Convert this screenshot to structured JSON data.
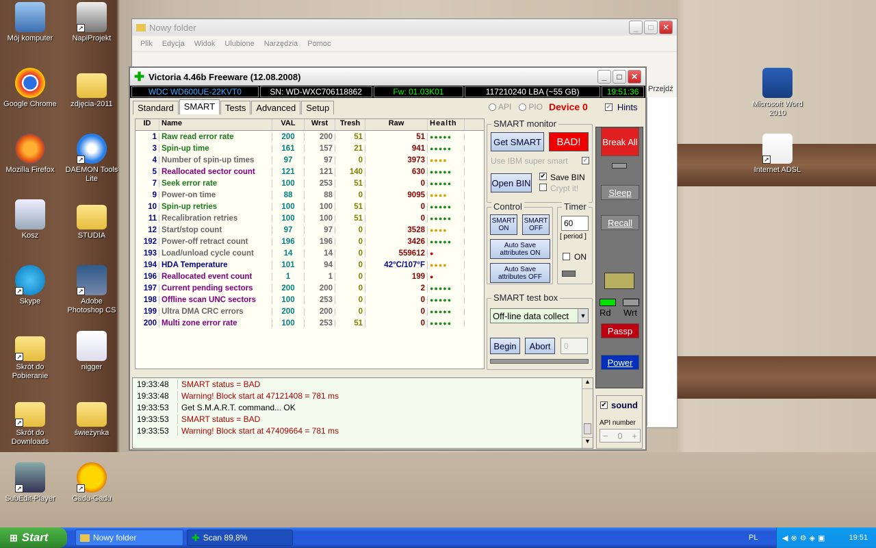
{
  "desktop": {
    "icons": [
      {
        "label": "Mój komputer",
        "shortcut": false
      },
      {
        "label": "NapiProjekt",
        "shortcut": true
      },
      {
        "label": "Google Chrome",
        "shortcut": false
      },
      {
        "label": "zdjęcia-2011",
        "shortcut": false
      },
      {
        "label": "Mozilla Firefox",
        "shortcut": false
      },
      {
        "label": "DAEMON Tools Lite",
        "shortcut": true
      },
      {
        "label": "Kosz",
        "shortcut": false
      },
      {
        "label": "STUDIA",
        "shortcut": false
      },
      {
        "label": "Skype",
        "shortcut": true
      },
      {
        "label": "Adobe Photoshop CS",
        "shortcut": true
      },
      {
        "label": "Skrót do Pobieranie",
        "shortcut": true
      },
      {
        "label": "nigger",
        "shortcut": false
      },
      {
        "label": "Skrót do Downloads",
        "shortcut": true
      },
      {
        "label": "świeżynka",
        "shortcut": false
      },
      {
        "label": "SubEdit-Player",
        "shortcut": true
      },
      {
        "label": "Gadu-Gadu",
        "shortcut": true
      },
      {
        "label": "Microsoft Word 2010",
        "shortcut": false
      },
      {
        "label": "Internet ADSL",
        "shortcut": true
      }
    ]
  },
  "explorer": {
    "title": "Nowy folder",
    "menu": [
      "Plik",
      "Edycja",
      "Widok",
      "Ulubione",
      "Narzędzia",
      "Pomoc"
    ],
    "go_label": "Przejdź"
  },
  "victoria": {
    "title": "Victoria 4.46b Freeware (12.08.2008)",
    "info": {
      "model": "WDC WD600UE-22KVT0",
      "sn": "SN: WD-WXC706118862",
      "fw": "Fw: 01.03K01",
      "lba": "117210240 LBA (~55 GB)",
      "clock": "19:51:36"
    },
    "tabs": [
      "Standard",
      "SMART",
      "Tests",
      "Advanced",
      "Setup"
    ],
    "api_label": "API",
    "pio_label": "PIO",
    "device_label": "Device 0",
    "hints_label": "Hints",
    "grid_headers": [
      "ID",
      "Name",
      "VAL",
      "Wrst",
      "Tresh",
      "Raw",
      "Health"
    ],
    "rows": [
      {
        "id": "1",
        "name": "Raw read error rate",
        "val": "200",
        "wrst": "200",
        "tr": "51",
        "raw": "51",
        "h": "●●●●●",
        "nc": "#1a7a1a",
        "hc": "#1a8a1a"
      },
      {
        "id": "3",
        "name": "Spin-up time",
        "val": "161",
        "wrst": "157",
        "tr": "21",
        "raw": "941",
        "h": "●●●●●",
        "nc": "#1a7a1a",
        "hc": "#1a8a1a"
      },
      {
        "id": "4",
        "name": "Number of spin-up times",
        "val": "97",
        "wrst": "97",
        "tr": "0",
        "raw": "3973",
        "h": "●●●●",
        "nc": "#666",
        "hc": "#d9a000"
      },
      {
        "id": "5",
        "name": "Reallocated sector count",
        "val": "121",
        "wrst": "121",
        "tr": "140",
        "raw": "630",
        "h": "●●●●●",
        "nc": "#800080",
        "hc": "#1a8a1a"
      },
      {
        "id": "7",
        "name": "Seek error rate",
        "val": "100",
        "wrst": "253",
        "tr": "51",
        "raw": "0",
        "h": "●●●●●",
        "nc": "#1a7a1a",
        "hc": "#1a8a1a"
      },
      {
        "id": "9",
        "name": "Power-on time",
        "val": "88",
        "wrst": "88",
        "tr": "0",
        "raw": "9095",
        "h": "●●●●",
        "nc": "#666",
        "hc": "#d9a000"
      },
      {
        "id": "10",
        "name": "Spin-up retries",
        "val": "100",
        "wrst": "100",
        "tr": "51",
        "raw": "0",
        "h": "●●●●●",
        "nc": "#1a7a1a",
        "hc": "#1a8a1a"
      },
      {
        "id": "11",
        "name": "Recalibration retries",
        "val": "100",
        "wrst": "100",
        "tr": "51",
        "raw": "0",
        "h": "●●●●●",
        "nc": "#666",
        "hc": "#1a8a1a"
      },
      {
        "id": "12",
        "name": "Start/stop count",
        "val": "97",
        "wrst": "97",
        "tr": "0",
        "raw": "3528",
        "h": "●●●●",
        "nc": "#666",
        "hc": "#d9a000"
      },
      {
        "id": "192",
        "name": "Power-off retract count",
        "val": "196",
        "wrst": "196",
        "tr": "0",
        "raw": "3426",
        "h": "●●●●●",
        "nc": "#666",
        "hc": "#1a8a1a"
      },
      {
        "id": "193",
        "name": "Load/unload cycle count",
        "val": "14",
        "wrst": "14",
        "tr": "0",
        "raw": "559612",
        "h": "●",
        "nc": "#666",
        "hc": "#cc0000"
      },
      {
        "id": "194",
        "name": "HDA Temperature",
        "val": "101",
        "wrst": "94",
        "tr": "0",
        "raw": "42°C/107°F",
        "h": "●●●●",
        "nc": "#00008b",
        "hc": "#d9a000",
        "rc": "#00008b"
      },
      {
        "id": "196",
        "name": "Reallocated event count",
        "val": "1",
        "wrst": "1",
        "tr": "0",
        "raw": "199",
        "h": "●",
        "nc": "#800080",
        "hc": "#cc0000"
      },
      {
        "id": "197",
        "name": "Current pending sectors",
        "val": "200",
        "wrst": "200",
        "tr": "0",
        "raw": "2",
        "h": "●●●●●",
        "nc": "#800080",
        "hc": "#1a8a1a"
      },
      {
        "id": "198",
        "name": "Offline scan UNC sectors",
        "val": "100",
        "wrst": "253",
        "tr": "0",
        "raw": "0",
        "h": "●●●●●",
        "nc": "#800080",
        "hc": "#1a8a1a"
      },
      {
        "id": "199",
        "name": "Ultra DMA CRC errors",
        "val": "200",
        "wrst": "200",
        "tr": "0",
        "raw": "0",
        "h": "●●●●●",
        "nc": "#666",
        "hc": "#1a8a1a"
      },
      {
        "id": "200",
        "name": "Multi zone error rate",
        "val": "100",
        "wrst": "253",
        "tr": "51",
        "raw": "0",
        "h": "●●●●●",
        "nc": "#800080",
        "hc": "#1a8a1a"
      }
    ],
    "smart_monitor": {
      "title": "SMART monitor",
      "get": "Get SMART",
      "bad": "BAD!",
      "ibm": "Use IBM super smart",
      "open": "Open BIN",
      "save": "Save BIN",
      "crypt": "Crypt it!"
    },
    "control": {
      "title": "Control",
      "on": "SMART ON",
      "off": "SMART OFF",
      "auto_on": "Auto Save attributes ON",
      "auto_off": "Auto Save attributes OFF"
    },
    "timer": {
      "title": "Timer",
      "value": "60",
      "period": "[ period ]",
      "on": "ON"
    },
    "testbox": {
      "title": "SMART test box",
      "select": "Off-line data collect",
      "begin": "Begin",
      "abort": "Abort",
      "num": "0"
    },
    "side": {
      "break": "Break All",
      "sleep": "Sleep",
      "recall": "Recall",
      "rd": "Rd",
      "wrt": "Wrt",
      "passp": "Passp",
      "power": "Power",
      "sound": "sound",
      "api_number": "API number",
      "api_val": "0"
    },
    "log": [
      {
        "t": "19:33:48",
        "m": "SMART status = BAD",
        "c": "#b00000"
      },
      {
        "t": "19:33:48",
        "m": "Warning! Block start at 47121408 = 781 ms",
        "c": "#b00000"
      },
      {
        "t": "19:33:53",
        "m": "Get S.M.A.R.T. command... OK",
        "c": "#000"
      },
      {
        "t": "19:33:53",
        "m": "SMART status = BAD",
        "c": "#b00000"
      },
      {
        "t": "19:33:53",
        "m": "Warning! Block start at 47409664 = 781 ms",
        "c": "#b00000"
      }
    ]
  },
  "taskbar": {
    "start": "Start",
    "tasks": [
      "Nowy folder",
      "Scan 89,8%"
    ],
    "lang": "PL",
    "time": "19:51"
  }
}
